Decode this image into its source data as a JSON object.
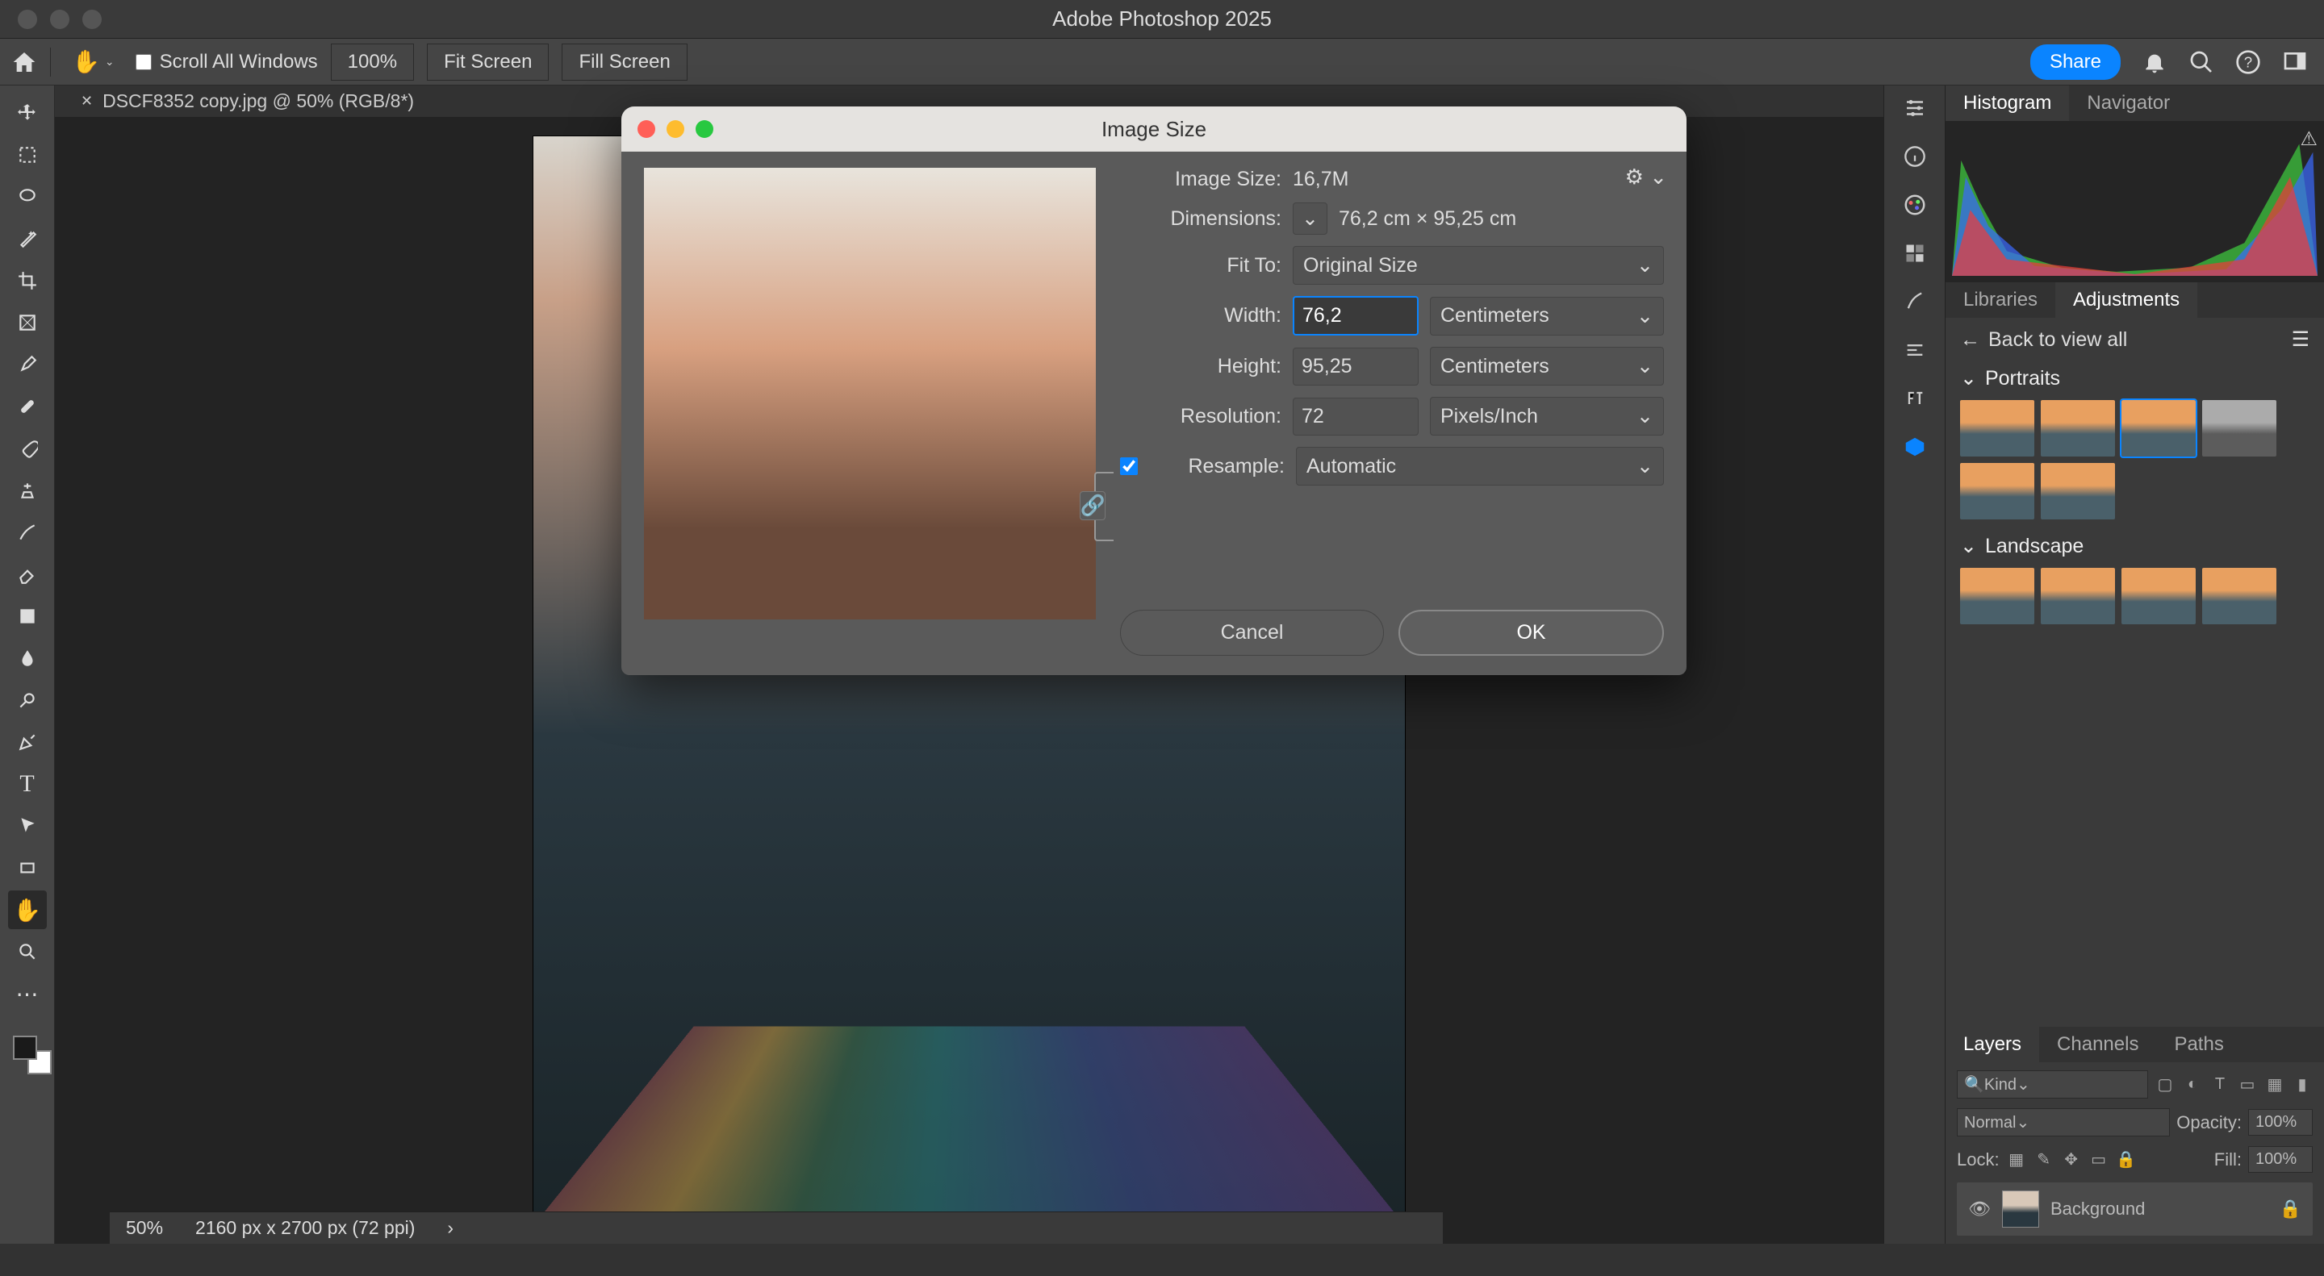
{
  "app_title": "Adobe Photoshop 2025",
  "optbar": {
    "scroll_all": "Scroll All Windows",
    "zoom": "100%",
    "fit_screen": "Fit Screen",
    "fill_screen": "Fill Screen",
    "share": "Share"
  },
  "document_tab": "DSCF8352 copy.jpg @ 50% (RGB/8*)",
  "statusbar": {
    "zoom": "50%",
    "dims": "2160 px x 2700 px (72 ppi)"
  },
  "panels": {
    "histogram": "Histogram",
    "navigator": "Navigator",
    "libraries": "Libraries",
    "adjustments": "Adjustments",
    "back": "Back to view all",
    "portraits": "Portraits",
    "landscape": "Landscape",
    "layers": "Layers",
    "channels": "Channels",
    "paths": "Paths",
    "kind": "Kind",
    "normal": "Normal",
    "opacity": "Opacity:",
    "opacity_val": "100%",
    "lock": "Lock:",
    "fill": "Fill:",
    "fill_val": "100%",
    "layer_name": "Background"
  },
  "dialog": {
    "title": "Image Size",
    "image_size_lbl": "Image Size:",
    "image_size_val": "16,7M",
    "dimensions_lbl": "Dimensions:",
    "dimensions_val": "76,2 cm  ×  95,25 cm",
    "fit_to_lbl": "Fit To:",
    "fit_to_val": "Original Size",
    "width_lbl": "Width:",
    "width_val": "76,2",
    "width_unit": "Centimeters",
    "height_lbl": "Height:",
    "height_val": "95,25",
    "height_unit": "Centimeters",
    "resolution_lbl": "Resolution:",
    "resolution_val": "72",
    "resolution_unit": "Pixels/Inch",
    "resample_lbl": "Resample:",
    "resample_val": "Automatic",
    "cancel": "Cancel",
    "ok": "OK"
  }
}
